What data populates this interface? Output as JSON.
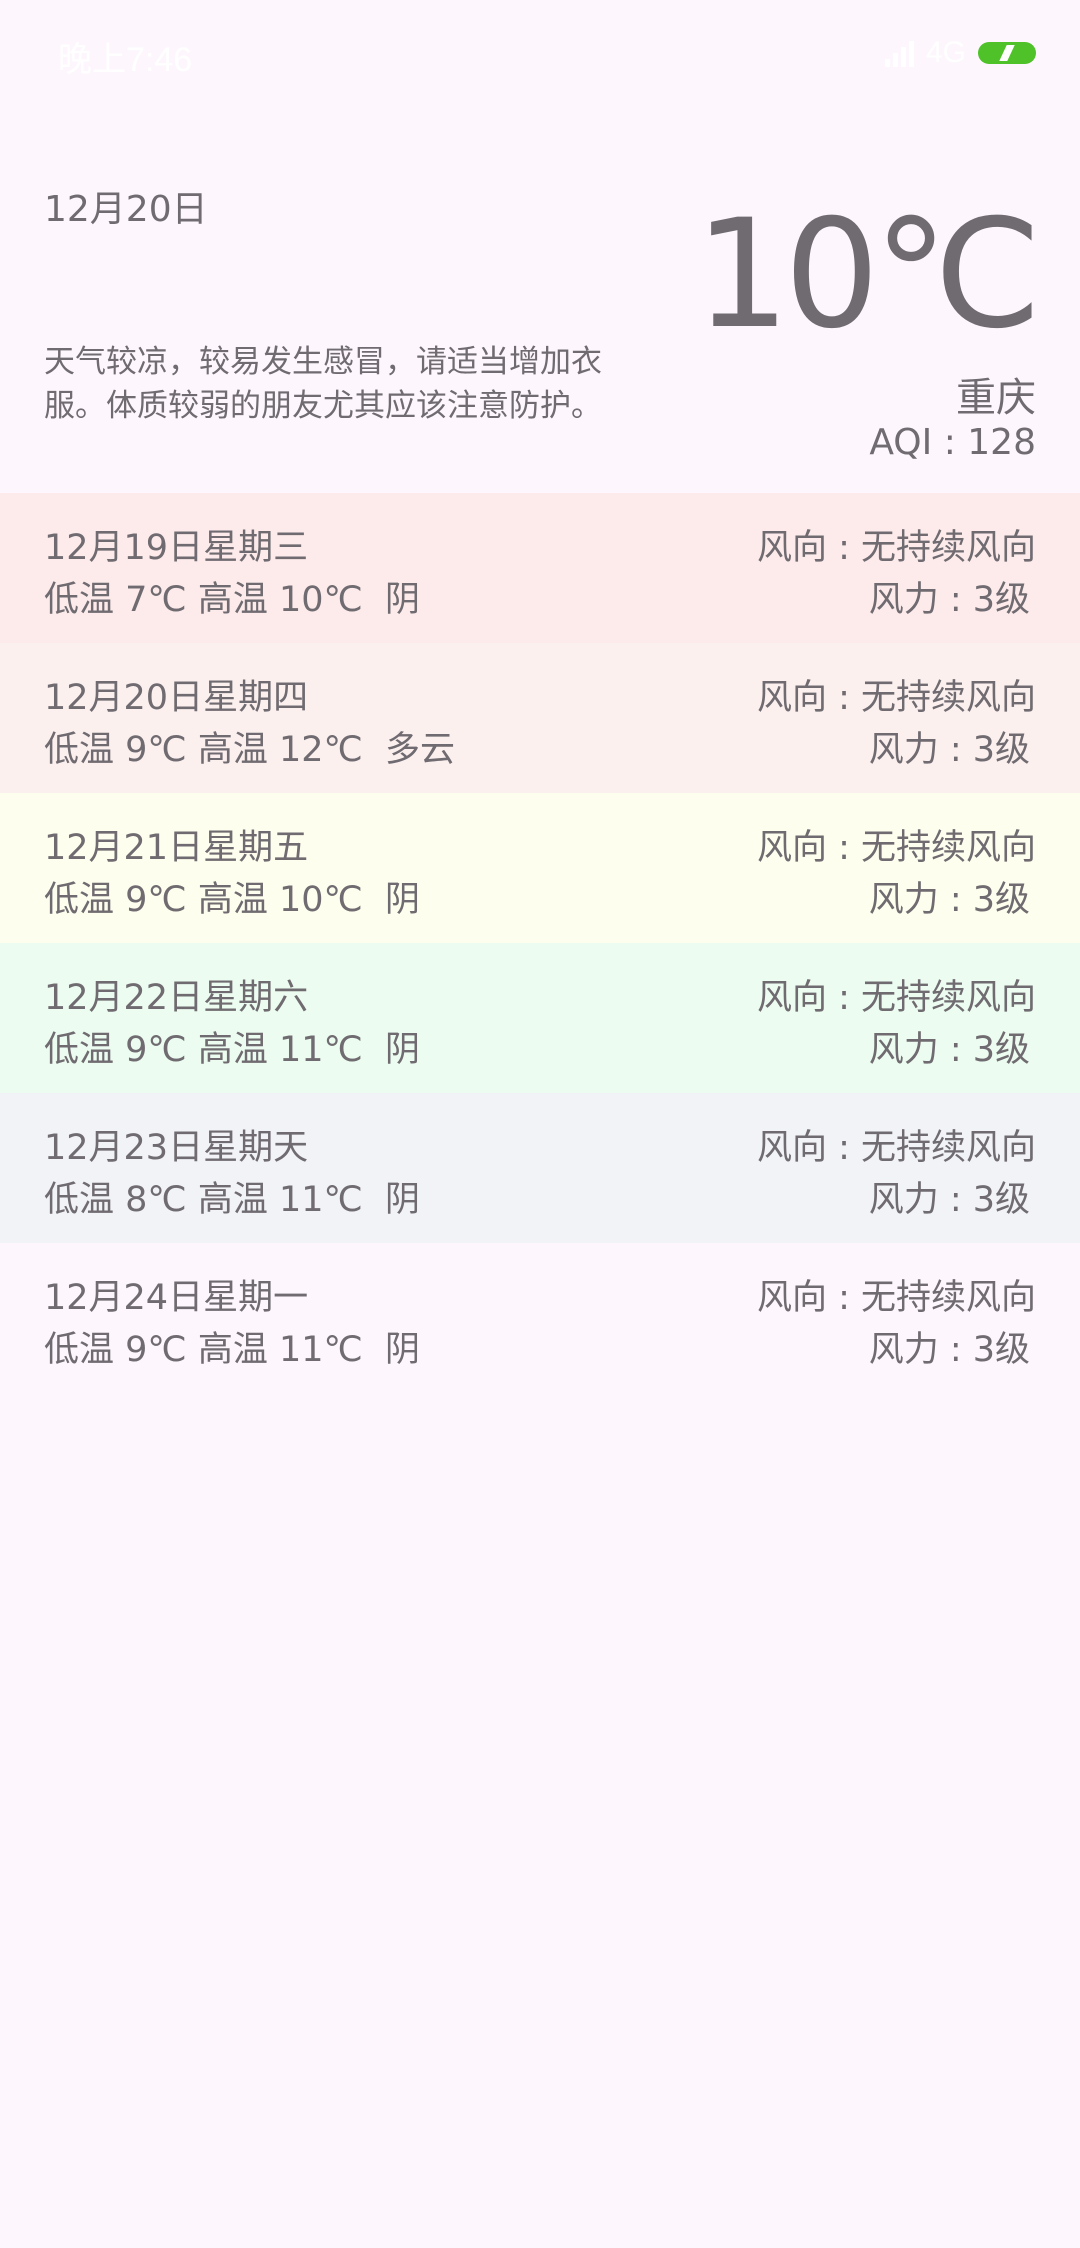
{
  "status_bar": {
    "time": "晚上7:46",
    "network": "4G",
    "signal_icon": "signal-icon",
    "battery_icon": "battery-icon",
    "battery_color": "#4fc22a"
  },
  "header": {
    "date": "12月20日",
    "temperature": "10℃",
    "tip": "天气较凉，较易发生感冒，请适当增加衣服。体质较弱的朋友尤其应该注意防护。",
    "city": "重庆",
    "aqi": "AQI : 128"
  },
  "forecast": [
    {
      "date": "12月19日星期三",
      "temp": "低温 7℃ 高温 10℃  阴",
      "wind_dir": "风向 : 无持续风向",
      "wind_power": "风力 : 3级",
      "bg": "#fdebeb"
    },
    {
      "date": "12月20日星期四",
      "temp": "低温 9℃ 高温 12℃  多云",
      "wind_dir": "风向 : 无持续风向",
      "wind_power": "风力 : 3级",
      "bg": "#fcf0ef"
    },
    {
      "date": "12月21日星期五",
      "temp": "低温 9℃ 高温 10℃  阴",
      "wind_dir": "风向 : 无持续风向",
      "wind_power": "风力 : 3级",
      "bg": "#fefeee"
    },
    {
      "date": "12月22日星期六",
      "temp": "低温 9℃ 高温 11℃  阴",
      "wind_dir": "风向 : 无持续风向",
      "wind_power": "风力 : 3级",
      "bg": "#ecfcf0"
    },
    {
      "date": "12月23日星期天",
      "temp": "低温 8℃ 高温 11℃  阴",
      "wind_dir": "风向 : 无持续风向",
      "wind_power": "风力 : 3级",
      "bg": "#f1f3f7"
    },
    {
      "date": "12月24日星期一",
      "temp": "低温 9℃ 高温 11℃  阴",
      "wind_dir": "风向 : 无持续风向",
      "wind_power": "风力 : 3级",
      "bg": "#fdf7fd"
    }
  ]
}
